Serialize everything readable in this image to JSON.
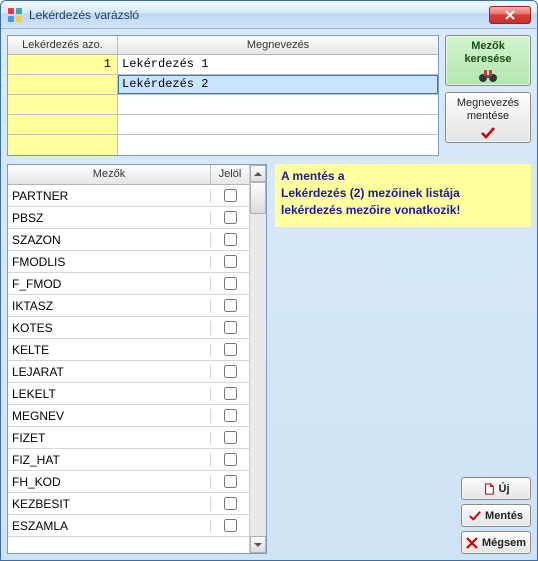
{
  "window": {
    "title": "Lekérdezés varázsló"
  },
  "queryTable": {
    "headers": {
      "id": "Lekérdezés azo.",
      "name": "Megnevezés"
    },
    "rows": [
      {
        "id": "1",
        "name": "Lekérdezés 1",
        "selected": false
      },
      {
        "id": "",
        "name": "Lekérdezés 2",
        "selected": true
      },
      {
        "id": "",
        "name": "",
        "selected": false
      },
      {
        "id": "",
        "name": "",
        "selected": false
      },
      {
        "id": "",
        "name": "",
        "selected": false
      }
    ]
  },
  "sideButtons": {
    "search": {
      "line1": "Mezők",
      "line2": "keresése"
    },
    "save": {
      "line1": "Megnevezés",
      "line2": "mentése"
    }
  },
  "fieldsTable": {
    "headers": {
      "field": "Mezők",
      "mark": "Jelöl"
    },
    "rows": [
      {
        "name": "PARTNER",
        "checked": false
      },
      {
        "name": "PBSZ",
        "checked": false
      },
      {
        "name": "SZAZON",
        "checked": false
      },
      {
        "name": "FMODLIS",
        "checked": false
      },
      {
        "name": "F_FMOD",
        "checked": false
      },
      {
        "name": "IKTASZ",
        "checked": false
      },
      {
        "name": "KOTES",
        "checked": false
      },
      {
        "name": "KELTE",
        "checked": false
      },
      {
        "name": "LEJARAT",
        "checked": false
      },
      {
        "name": "LEKELT",
        "checked": false
      },
      {
        "name": "MEGNEV",
        "checked": false
      },
      {
        "name": "FIZET",
        "checked": false
      },
      {
        "name": "FIZ_HAT",
        "checked": false
      },
      {
        "name": "FH_KOD",
        "checked": false
      },
      {
        "name": "KEZBESIT",
        "checked": false
      },
      {
        "name": "ESZAMLA",
        "checked": false
      }
    ]
  },
  "info": {
    "line1": "A mentés a",
    "line2": "Lekérdezés (2) mezőinek listája",
    "line3": "lekérdezés mezőire vonatkozik!"
  },
  "actions": {
    "new": "Új",
    "save": "Mentés",
    "cancel": "Mégsem"
  }
}
